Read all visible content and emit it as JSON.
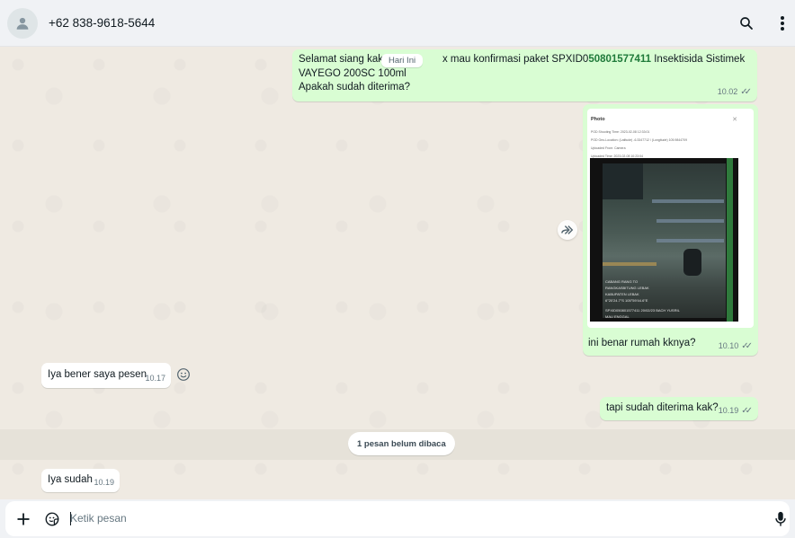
{
  "header": {
    "contact_name": "+62 838-9618-5644",
    "icons": [
      "person-icon",
      "search-icon",
      "more-vertical-icon"
    ]
  },
  "chat": {
    "date_chip": "Hari Ini",
    "messages": [
      {
        "direction": "out",
        "text_pre": "Selamat siang kak",
        "text_mid": "x mau konfirmasi paket SPXID0",
        "spx_number": "50801577411",
        "text_post": " Insektisida Sistimek",
        "line2": "VAYEGO 200SC 100ml",
        "line3": "Apakah sudah diterima?",
        "time": "10.02",
        "status": "read"
      },
      {
        "direction": "out",
        "type": "image",
        "photo_title": "Photo",
        "photo_lines": [
          "POD Shooting Time:  2023-02-08 12:33:01",
          "POD Geo-Location:  (Latitude) -6.3347712 / (Longitude) 105.9844709",
          "Uploaded From: Camera",
          "Uploaded Time: 2023-02-08 10:23:04"
        ],
        "overlay_lines": [
          "CABANG RANG TO",
          "RANGKASBITUNG LEBAK",
          "KABUPATEN LEBAK",
          "6°20'24.7\"S 105°59'44.6\"E",
          "SPXID050801577411  20/02/23 BACH YUSRIL",
          "MAU ENGGAL"
        ],
        "caption": "ini benar rumah kknya?",
        "time": "10.10",
        "status": "read"
      },
      {
        "direction": "in",
        "text": "Iya bener saya pesen",
        "time": "10.17"
      },
      {
        "direction": "out",
        "text": "tapi sudah diterima kak?",
        "time": "10.19",
        "status": "read"
      },
      {
        "direction": "in",
        "text": "Iya sudah",
        "time": "10.19"
      }
    ],
    "unread_label": "1 pesan belum dibaca"
  },
  "composer": {
    "placeholder": "Ketik pesan",
    "icons": [
      "plus-icon",
      "sticker-icon",
      "microphone-icon"
    ]
  },
  "colors": {
    "outgoing_bubble": "#d9fdd3",
    "incoming_bubble": "#ffffff",
    "chat_background": "#efeae2",
    "header_background": "#f0f2f5",
    "spx_number": "#1f7a3a"
  }
}
